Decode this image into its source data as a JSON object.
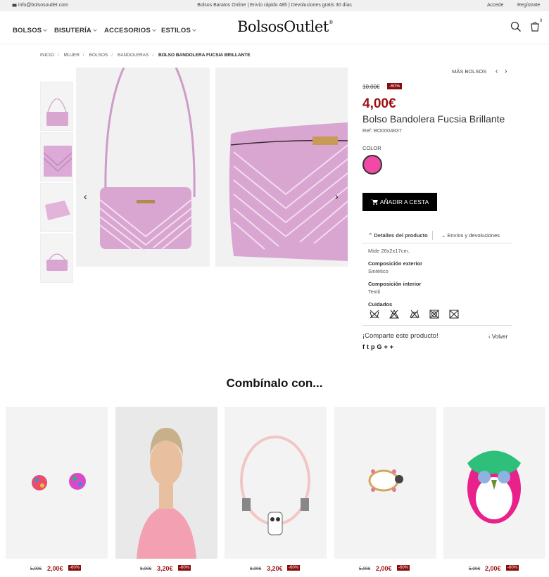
{
  "topbar": {
    "email": "info@bolsosoutlet.com",
    "tagline": "Bolsos Baratos Online | Envío rápido 48h | Devoluciones gratis 30 días",
    "login": "Accede",
    "register": "Regístrate"
  },
  "nav": {
    "items": [
      "BOLSOS",
      "BISUTERÍA",
      "ACCESORIOS",
      "ESTILOS"
    ],
    "logo": "BolsosOutlet",
    "logo_mark": "®",
    "cart_count": "0",
    "icons": [
      "search-icon",
      "cart-icon",
      "envelope-icon"
    ]
  },
  "breadcrumb": [
    "INICIO",
    "MUJER",
    "BOLSOS",
    "BANDOLERAS",
    "BOLSO BANDOLERA FUCSIA BRILLANTE"
  ],
  "product": {
    "more_label": "MÁS BOLSOS",
    "old_price": "10,00€",
    "discount": "-60%",
    "price": "4,00€",
    "title": "Bolso Bandolera Fucsia Brillante",
    "ref": "Ref: BO0004837",
    "color_label": "COLOR",
    "color_hex": "#f249a6",
    "add_to_cart": "AÑADIR A CESTA",
    "tab_details": "Detalles del producto",
    "tab_shipping": "Envíos y devoluciones",
    "size": "Mide 26x2x17cm.",
    "comp_ext_label": "Composición exterior",
    "comp_ext": "Sintético",
    "comp_int_label": "Composición interior",
    "comp_int": "Textil",
    "care_label": "Cuidados",
    "share": "¡Comparte este producto!",
    "back": "Volver",
    "social_icons": [
      "facebook-icon",
      "twitter-icon",
      "pinterest-icon",
      "google-plus-icon",
      "plus-icon"
    ]
  },
  "related": {
    "title": "Combínalo con...",
    "items": [
      {
        "old": "5,00€",
        "price": "2,00€",
        "discount": "-60%",
        "kind": "earrings"
      },
      {
        "old": "8,00€",
        "price": "3,20€",
        "discount": "-60%",
        "kind": "model"
      },
      {
        "old": "8,00€",
        "price": "3,20€",
        "discount": "-60%",
        "kind": "necklace"
      },
      {
        "old": "5,00€",
        "price": "2,00€",
        "discount": "-60%",
        "kind": "turtle-brooch"
      },
      {
        "old": "5,00€",
        "price": "2,00€",
        "discount": "-60%",
        "kind": "owl-brooch"
      }
    ]
  },
  "colors": {
    "accent": "#9b1111",
    "badge": "#8c0b0b",
    "bag_pink": "#d9a6d2"
  }
}
